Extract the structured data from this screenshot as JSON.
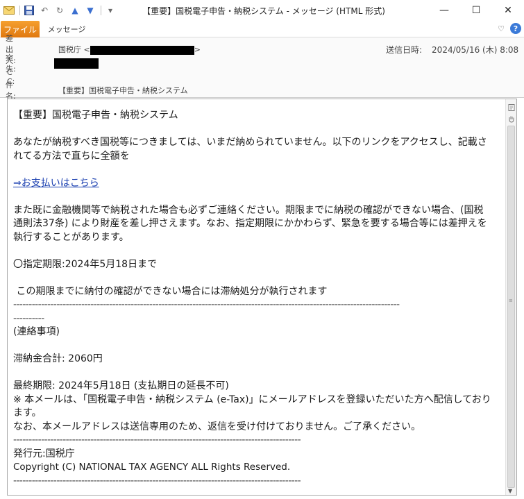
{
  "window": {
    "title": "【重要】国税電子申告・納税システム - メッセージ (HTML 形式)",
    "minimize_glyph": "—",
    "maximize_glyph": "☐",
    "close_glyph": "✕"
  },
  "qat": {
    "save_glyph": "💾",
    "undo_glyph": "↶",
    "redo_glyph": "↻",
    "up_glyph": "▲",
    "down_glyph": "▼",
    "customize_glyph": "▾"
  },
  "ribbon": {
    "file_tab": "ファイル",
    "message_tab": "メッセージ",
    "collapse_glyph": "♡",
    "help_glyph": "?"
  },
  "headers": {
    "from_label": "差出人:",
    "from_name": "国税庁 <",
    "from_suffix": ">",
    "to_label": "宛先:",
    "cc_label": "C C:",
    "subject_label": "件名:",
    "subject_value": "【重要】国税電子申告・納税システム",
    "sent_label": "送信日時:",
    "sent_value": "2024/05/16 (木) 8:08"
  },
  "body": {
    "heading": "【重要】国税電子申告・納税システム",
    "para1": "あなたが納税すべき国税等につきましては、いまだ納められていません。以下のリンクをアクセスし、記載されてる方法で直ちに全額を",
    "link": "⇒お支払いはこちら",
    "para2": "また既に金融機関等で納税された場合も必ずご連絡ください。期限までに納税の確認ができない場合、(国税通則法37条) により財産を差し押さえます。なお、指定期限にかかわらず、緊急を要する場合等には差押えを執行することがあります。",
    "deadline": "〇指定期限:2024年5月18日まで",
    "warning": " この期限までに納付の確認ができない場合には滞納処分が執行されます",
    "divider_long": "-----------------------------------------------------------------------------------------------------------------------------",
    "divider_cont": "----------",
    "contact_header": "(連絡事項)",
    "amount": "滞納金合計: 2060円",
    "final_deadline": "最終期限: 2024年5月18日 (支払期日の延長不可)",
    "note1": "※ 本メールは、「国税電子申告・納税システム (e-Tax)」にメールアドレスを登録いただいた方へ配信しております。",
    "note2": "なお、本メールアドレスは送信専用のため、返信を受け付けておりません。ご了承ください。",
    "divider_short": "---------------------------------------------------------------------------------------------",
    "issuer": "発行元:国税庁",
    "copyright": "Copyright (C) NATIONAL TAX AGENCY ALL Rights Reserved.",
    "divider_end": "---------------------------------------------------------------------------------------------"
  }
}
